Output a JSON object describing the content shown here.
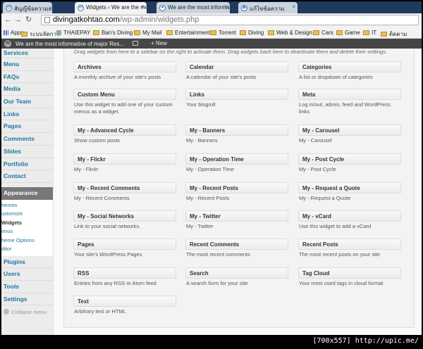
{
  "browser": {
    "tabs": [
      {
        "label": "สัญญีข้อความส่งแล้ว",
        "active": false
      },
      {
        "label": "Widgets ‹ We are the mo",
        "active": true
      },
      {
        "label": "We are the most informati",
        "active": false
      },
      {
        "label": "แก้ไขข้อความ",
        "active": false
      }
    ],
    "url_host": "divingatkohtao.com",
    "url_path": "/wp-admin/widgets.php",
    "bookmarks": [
      "Apps",
      "ระบบจัดการ",
      "THAIEPAY",
      "Ban's Diving",
      "My Mail",
      "Entertainment",
      "Torrent",
      "Diving",
      "Web & Design",
      "Cars",
      "Game",
      "IT",
      "ติดตาม"
    ]
  },
  "adminbar": {
    "site_name": "We are the most informative of major Res...",
    "comments_count": "",
    "new_label": "New"
  },
  "sidebar": {
    "items_top": [
      "Services",
      "Menu",
      "FAQs",
      "Media",
      "Our Team",
      "Links",
      "Pages",
      "Comments",
      "Slides",
      "Portfolio",
      "Contact"
    ],
    "current": "Appearance",
    "submenu": [
      "hemes",
      "ustomize",
      "Widgets",
      "enus",
      "heme Options",
      "ditor"
    ],
    "items_bottom": [
      "Plugins",
      "Users",
      "Tools",
      "Settings"
    ],
    "collapse_label": "Collapse menu"
  },
  "main": {
    "description": "Drag widgets from here to a sidebar on the right to activate them. Drag widgets back here to deactivate them and delete their settings.",
    "widgets": [
      {
        "title": "Archives",
        "desc": "A monthly archive of your site's posts"
      },
      {
        "title": "Calendar",
        "desc": "A calendar of your site's posts"
      },
      {
        "title": "Categories",
        "desc": "A list or dropdown of categories"
      },
      {
        "title": "Custom Menu",
        "desc": "Use this widget to add one of your custom menus as a widget."
      },
      {
        "title": "Links",
        "desc": "Your blogroll"
      },
      {
        "title": "Meta",
        "desc": "Log in/out, admin, feed and WordPress links"
      },
      {
        "title": "My - Advanced Cycle",
        "desc": "Show custom posts"
      },
      {
        "title": "My - Banners",
        "desc": "My - Banners"
      },
      {
        "title": "My - Carousel",
        "desc": "My - Carousel"
      },
      {
        "title": "My - Flickr",
        "desc": "My - Flickr"
      },
      {
        "title": "My - Operation Time",
        "desc": "My - Operation Time"
      },
      {
        "title": "My - Post Cycle",
        "desc": "My - Post Cycle"
      },
      {
        "title": "My - Recent Comments",
        "desc": "My - Recent Comments"
      },
      {
        "title": "My - Recent Posts",
        "desc": "My - Recent Posts"
      },
      {
        "title": "My - Request a Quote",
        "desc": "My - Request a Quote"
      },
      {
        "title": "My - Social Networks",
        "desc": "Link to your social networks."
      },
      {
        "title": "My - Twitter",
        "desc": "My - Twitter"
      },
      {
        "title": "My - vCard",
        "desc": "Use this widget to add a vCard"
      },
      {
        "title": "Pages",
        "desc": "Your site's WordPress Pages"
      },
      {
        "title": "Recent Comments",
        "desc": "The most recent comments"
      },
      {
        "title": "Recent Posts",
        "desc": "The most recent posts on your site"
      },
      {
        "title": "RSS",
        "desc": "Entries from any RSS or Atom feed"
      },
      {
        "title": "Search",
        "desc": "A search form for your site"
      },
      {
        "title": "Tag Cloud",
        "desc": "Your most used tags in cloud format"
      },
      {
        "title": "Text",
        "desc": "Arbitrary text or HTML"
      }
    ]
  },
  "watermark": "[700x557] http://upic.me/",
  "colors": {
    "admin_bar": "#464646",
    "menu_current": "#777777",
    "link": "#21759b",
    "tab_strip": "#1f3a5c"
  }
}
